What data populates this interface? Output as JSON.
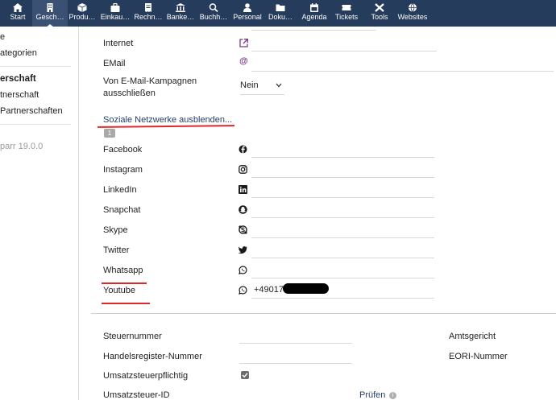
{
  "nav": {
    "items": [
      {
        "label": "Start",
        "icon": "home-icon"
      },
      {
        "label": "Gesch…",
        "icon": "building-icon"
      },
      {
        "label": "Produ…",
        "icon": "cube-icon"
      },
      {
        "label": "Einkau…",
        "icon": "briefcase-icon"
      },
      {
        "label": "Rechn…",
        "icon": "invoice-icon"
      },
      {
        "label": "Banke…",
        "icon": "bank-icon"
      },
      {
        "label": "Buchh…",
        "icon": "magnifier-icon"
      },
      {
        "label": "Personal",
        "icon": "user-icon"
      },
      {
        "label": "Doku…",
        "icon": "folder-icon"
      },
      {
        "label": "Agenda",
        "icon": "calendar-icon"
      },
      {
        "label": "Tickets",
        "icon": "ticket-icon"
      },
      {
        "label": "Tools",
        "icon": "tools-icon"
      },
      {
        "label": "Websites",
        "icon": "globe-icon"
      }
    ],
    "active_index": 1
  },
  "sidebar": {
    "link1": "e",
    "link2": "ategorien",
    "section_title": "erschaft",
    "link3": "tnerschaft",
    "link4": "Partnerschaften",
    "version": "parr 19.0.0"
  },
  "form": {
    "internet_label": "Internet",
    "email_label": "EMail",
    "email_campaign_label_line1": "Von E-Mail-Kampagnen",
    "email_campaign_label_line2": "ausschließen",
    "email_campaign_value": "Nein",
    "social_toggle": "Soziale Netzwerke ausblenden...",
    "social_badge": "1",
    "social": [
      {
        "label": "Facebook",
        "icon": "facebook-icon",
        "value": ""
      },
      {
        "label": "Instagram",
        "icon": "instagram-icon",
        "value": ""
      },
      {
        "label": "LinkedIn",
        "icon": "linkedin-icon",
        "value": ""
      },
      {
        "label": "Snapchat",
        "icon": "snapchat-icon",
        "value": ""
      },
      {
        "label": "Skype",
        "icon": "skype-icon",
        "value": ""
      },
      {
        "label": "Twitter",
        "icon": "twitter-icon",
        "value": ""
      },
      {
        "label": "Whatsapp",
        "icon": "whatsapp-icon",
        "value": ""
      },
      {
        "label": "Youtube",
        "icon": "whatsapp-icon",
        "value": "+49017"
      }
    ],
    "steuernummer_label": "Steuernummer",
    "handelsregister_label": "Handelsregister-Nummer",
    "ust_pflichtig_label": "Umsatzsteuerpflichtig",
    "ust_id_label": "Umsatzsteuer-ID",
    "pruefen_label": "Prüfen",
    "amtsgericht_label": "Amtsgericht",
    "eori_label": "EORI-Nummer"
  },
  "colors": {
    "nav_bg": "#263c5c",
    "link": "#27406b",
    "annotation_red": "#e0262a",
    "icon_purple": "#7a3a8a"
  }
}
